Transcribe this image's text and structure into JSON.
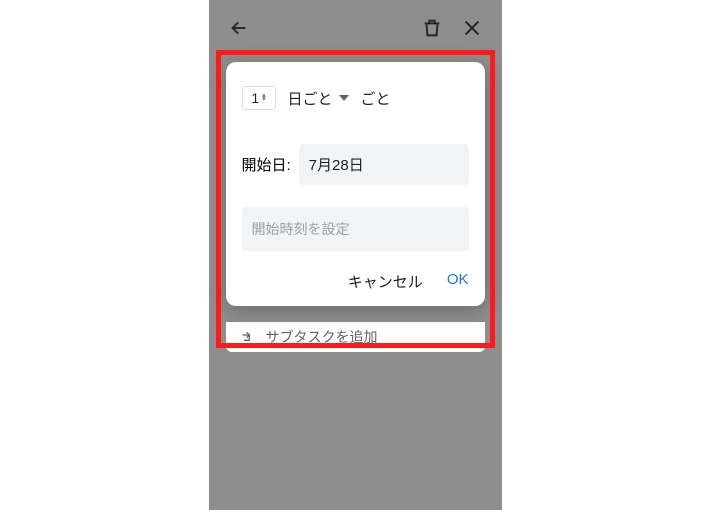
{
  "topbar": {
    "back_icon": "back-arrow",
    "delete_icon": "trash",
    "close_icon": "close"
  },
  "dialog": {
    "interval_value": "1",
    "unit_label": "日ごと",
    "suffix_label": "ごと",
    "start_date_label": "開始日:",
    "start_date_value": "7月28日",
    "start_time_placeholder": "開始時刻を設定",
    "cancel_label": "キャンセル",
    "ok_label": "OK"
  },
  "background": {
    "add_subtask_label": "サブタスクを追加"
  }
}
